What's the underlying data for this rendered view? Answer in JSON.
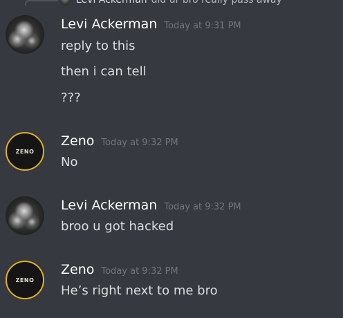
{
  "reply_preview": {
    "author": "Levi Ackerman",
    "text": "did ur bro really pass away"
  },
  "messages": [
    {
      "author": "Levi Ackerman",
      "timestamp": "Today at 9:31 PM",
      "lines": [
        "reply to this",
        "then i can tell",
        "???"
      ]
    },
    {
      "author": "Zeno",
      "avatar_text": "ZENO",
      "timestamp": "Today at 9:32 PM",
      "lines": [
        "No"
      ]
    },
    {
      "author": "Levi Ackerman",
      "timestamp": "Today at 9:32 PM",
      "lines": [
        "broo u got hacked"
      ]
    },
    {
      "author": "Zeno",
      "avatar_text": "ZENO",
      "timestamp": "Today at 9:32 PM",
      "lines": [
        "He’s right next to me bro"
      ]
    }
  ],
  "colors": {
    "background": "#36393f",
    "username": "#ffffff",
    "text": "#dcddde",
    "timestamp": "#72767d",
    "zeno_ring": "#e0b21a"
  }
}
